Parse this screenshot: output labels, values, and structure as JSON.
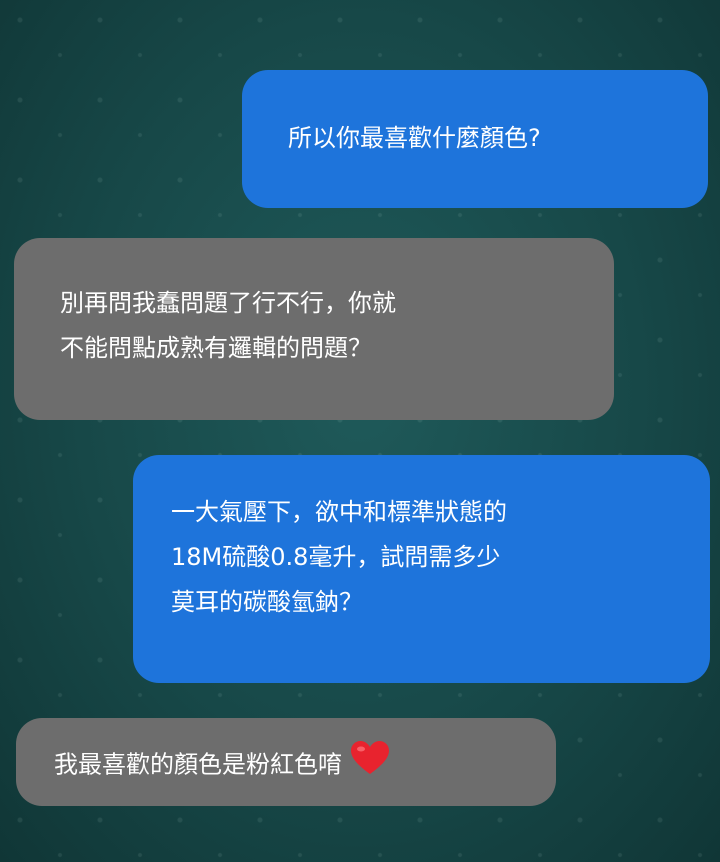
{
  "messages": [
    {
      "side": "out",
      "lines": [
        "所以你最喜歡什麼顏色?"
      ]
    },
    {
      "side": "in",
      "lines": [
        "別再問我蠢問題了行不行，你就",
        "不能問點成熟有邏輯的問題？"
      ]
    },
    {
      "side": "out",
      "lines": [
        "一大氣壓下，欲中和標準狀態的",
        "18M硫酸0.8毫升，試問需多少",
        "莫耳的碳酸氫鈉？"
      ]
    },
    {
      "side": "in",
      "lines": [
        "我最喜歡的顏色是粉紅色唷"
      ],
      "emoji": "heart-emoji"
    }
  ],
  "colors": {
    "outgoing": "#1e74db",
    "incoming": "#6d6d6d",
    "heart": "#e8232e"
  }
}
